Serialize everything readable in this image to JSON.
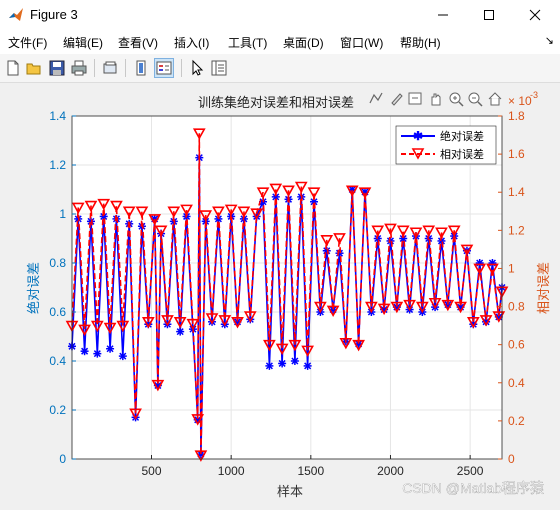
{
  "window": {
    "title": "Figure 3"
  },
  "menu": [
    "文件(F)",
    "编辑(E)",
    "查看(V)",
    "插入(I)",
    "工具(T)",
    "桌面(D)",
    "窗口(W)",
    "帮助(H)"
  ],
  "toolbar_icons": [
    "new-figure-icon",
    "open-icon",
    "save-icon",
    "print-icon",
    "link-icon",
    "colorbar-icon",
    "legend-icon",
    "pointer-icon",
    "property-inspector-icon"
  ],
  "axes_toolbar_icons": [
    "export-icon",
    "brush-icon",
    "datatip-icon",
    "pan-icon",
    "zoom-in-icon",
    "zoom-out-icon",
    "home-icon"
  ],
  "watermark": "CSDN @Matlab程序猿",
  "colors": {
    "abs": "#0000ff",
    "rel": "#ff0000",
    "left_axis": "#0072bd",
    "right_axis": "#d95319"
  },
  "chart_data": {
    "type": "line",
    "title": "训练集绝对误差和相对误差",
    "xlabel": "样本",
    "ylabel_left": "绝对误差",
    "ylabel_right": "相对误差",
    "right_exponent_base": "× 10",
    "right_exponent_power": "-3",
    "xlim": [
      1,
      2700
    ],
    "ylim_left": [
      0,
      1.4
    ],
    "ylim_right": [
      0,
      1.8
    ],
    "xticks": [
      500,
      1000,
      1500,
      2000,
      2500
    ],
    "yticks_left": [
      0,
      0.2,
      0.4,
      0.6,
      0.8,
      1,
      1.2,
      1.4
    ],
    "yticks_right": [
      0,
      0.2,
      0.4,
      0.6,
      0.8,
      1,
      1.2,
      1.4,
      1.6,
      1.8
    ],
    "legend_location": "top-right",
    "grid": true,
    "series": [
      {
        "name": "绝对误差",
        "axis": "left",
        "marker": "asterisk",
        "line": "solid",
        "x": [
          1,
          40,
          80,
          120,
          160,
          200,
          240,
          280,
          320,
          360,
          400,
          440,
          480,
          520,
          540,
          560,
          600,
          640,
          680,
          720,
          760,
          790,
          800,
          810,
          840,
          880,
          920,
          960,
          1000,
          1040,
          1080,
          1120,
          1160,
          1200,
          1240,
          1280,
          1320,
          1360,
          1400,
          1440,
          1480,
          1520,
          1560,
          1600,
          1640,
          1680,
          1720,
          1760,
          1800,
          1840,
          1880,
          1920,
          1960,
          2000,
          2040,
          2080,
          2120,
          2160,
          2200,
          2240,
          2280,
          2320,
          2360,
          2400,
          2440,
          2480,
          2520,
          2560,
          2600,
          2640,
          2680,
          2700
        ],
        "y": [
          0.46,
          0.98,
          0.44,
          0.97,
          0.43,
          0.99,
          0.45,
          0.98,
          0.42,
          0.96,
          0.17,
          0.95,
          0.55,
          0.98,
          0.3,
          0.92,
          0.55,
          0.97,
          0.52,
          0.99,
          0.53,
          0.16,
          1.23,
          0.02,
          0.97,
          0.56,
          0.98,
          0.55,
          0.99,
          0.56,
          0.98,
          0.57,
          0.99,
          1.05,
          0.38,
          1.07,
          0.39,
          1.06,
          0.4,
          1.07,
          0.38,
          1.05,
          0.6,
          0.85,
          0.61,
          0.84,
          0.48,
          1.1,
          0.47,
          1.09,
          0.6,
          0.9,
          0.61,
          0.89,
          0.62,
          0.9,
          0.61,
          0.91,
          0.6,
          0.9,
          0.62,
          0.89,
          0.63,
          0.91,
          0.62,
          0.85,
          0.55,
          0.8,
          0.56,
          0.8,
          0.58,
          0.7
        ]
      },
      {
        "name": "相对误差",
        "axis": "right",
        "marker": "triangle-down",
        "line": "dashed",
        "x": [
          1,
          40,
          80,
          120,
          160,
          200,
          240,
          280,
          320,
          360,
          400,
          440,
          480,
          520,
          540,
          560,
          600,
          640,
          680,
          720,
          760,
          790,
          800,
          810,
          840,
          880,
          920,
          960,
          1000,
          1040,
          1080,
          1120,
          1160,
          1200,
          1240,
          1280,
          1320,
          1360,
          1400,
          1440,
          1480,
          1520,
          1560,
          1600,
          1640,
          1680,
          1720,
          1760,
          1800,
          1840,
          1880,
          1920,
          1960,
          2000,
          2040,
          2080,
          2120,
          2160,
          2200,
          2240,
          2280,
          2320,
          2360,
          2400,
          2440,
          2480,
          2520,
          2560,
          2600,
          2640,
          2680,
          2700
        ],
        "y": [
          0.7,
          1.32,
          0.68,
          1.33,
          0.7,
          1.34,
          0.69,
          1.33,
          0.7,
          1.3,
          0.24,
          1.3,
          0.72,
          1.26,
          0.39,
          1.2,
          0.73,
          1.3,
          0.72,
          1.31,
          0.71,
          0.21,
          1.71,
          0.02,
          1.28,
          0.74,
          1.3,
          0.73,
          1.31,
          0.72,
          1.3,
          0.75,
          1.29,
          1.4,
          0.6,
          1.42,
          0.58,
          1.41,
          0.6,
          1.43,
          0.57,
          1.4,
          0.8,
          1.15,
          0.78,
          1.16,
          0.61,
          1.41,
          0.6,
          1.4,
          0.8,
          1.2,
          0.79,
          1.21,
          0.8,
          1.2,
          0.81,
          1.19,
          0.8,
          1.2,
          0.82,
          1.19,
          0.81,
          1.2,
          0.8,
          1.1,
          0.72,
          1.0,
          0.73,
          1.0,
          0.75,
          0.88
        ]
      }
    ]
  }
}
